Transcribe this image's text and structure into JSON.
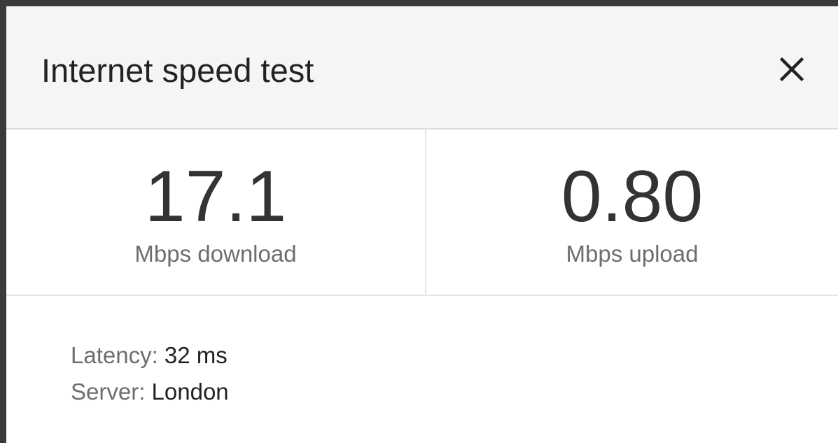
{
  "dialog": {
    "title": "Internet speed test",
    "close_icon": "close-icon"
  },
  "metrics": {
    "download": {
      "value": "17.1",
      "label": "Mbps download"
    },
    "upload": {
      "value": "0.80",
      "label": "Mbps upload"
    }
  },
  "details": {
    "latency": {
      "key": "Latency: ",
      "value": "32 ms"
    },
    "server": {
      "key": "Server: ",
      "value": "London"
    }
  },
  "colors": {
    "header_background": "#f5f5f5",
    "frame_border": "#3a3a3a",
    "value_text": "#333333",
    "muted_text": "#6e6e6e"
  }
}
